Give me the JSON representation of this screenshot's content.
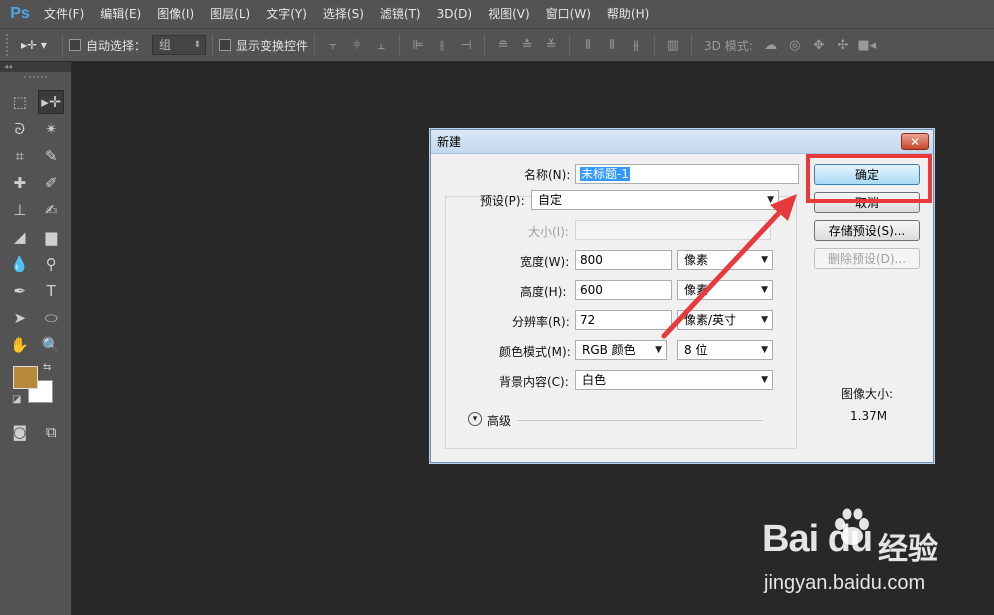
{
  "app": {
    "logo": "Ps"
  },
  "menu": [
    "文件(F)",
    "编辑(E)",
    "图像(I)",
    "图层(L)",
    "文字(Y)",
    "选择(S)",
    "滤镜(T)",
    "3D(D)",
    "视图(V)",
    "窗口(W)",
    "帮助(H)"
  ],
  "options_bar": {
    "auto_select_label": "自动选择：",
    "auto_select_value": "组",
    "show_transform_label": "显示变换控件",
    "mode3d_label": "3D 模式:"
  },
  "dialog": {
    "title": "新建",
    "close": "✕",
    "name_label": "名称(N):",
    "name_value": "未标题-1",
    "preset_label": "预设(P):",
    "preset_value": "自定",
    "size_label": "大小(I):",
    "width_label": "宽度(W):",
    "width_value": "800",
    "width_unit": "像素",
    "height_label": "高度(H):",
    "height_value": "600",
    "height_unit": "像素",
    "resolution_label": "分辨率(R):",
    "resolution_value": "72",
    "resolution_unit": "像素/英寸",
    "color_mode_label": "颜色模式(M):",
    "color_mode_value": "RGB 颜色",
    "bit_depth_value": "8 位",
    "background_label": "背景内容(C):",
    "background_value": "白色",
    "advanced_label": "高级",
    "ok_button": "确定",
    "cancel_button": "取消",
    "save_preset_button": "存储预设(S)...",
    "delete_preset_button": "删除预设(D)...",
    "image_size_label": "图像大小:",
    "image_size_value": "1.37M"
  },
  "watermark": {
    "brand": "Bai  du",
    "cn": "经验",
    "url": "jingyan.baidu.com"
  },
  "colors": {
    "foreground": "#b8893b",
    "background": "#ffffff",
    "annotation": "#e8393c"
  }
}
